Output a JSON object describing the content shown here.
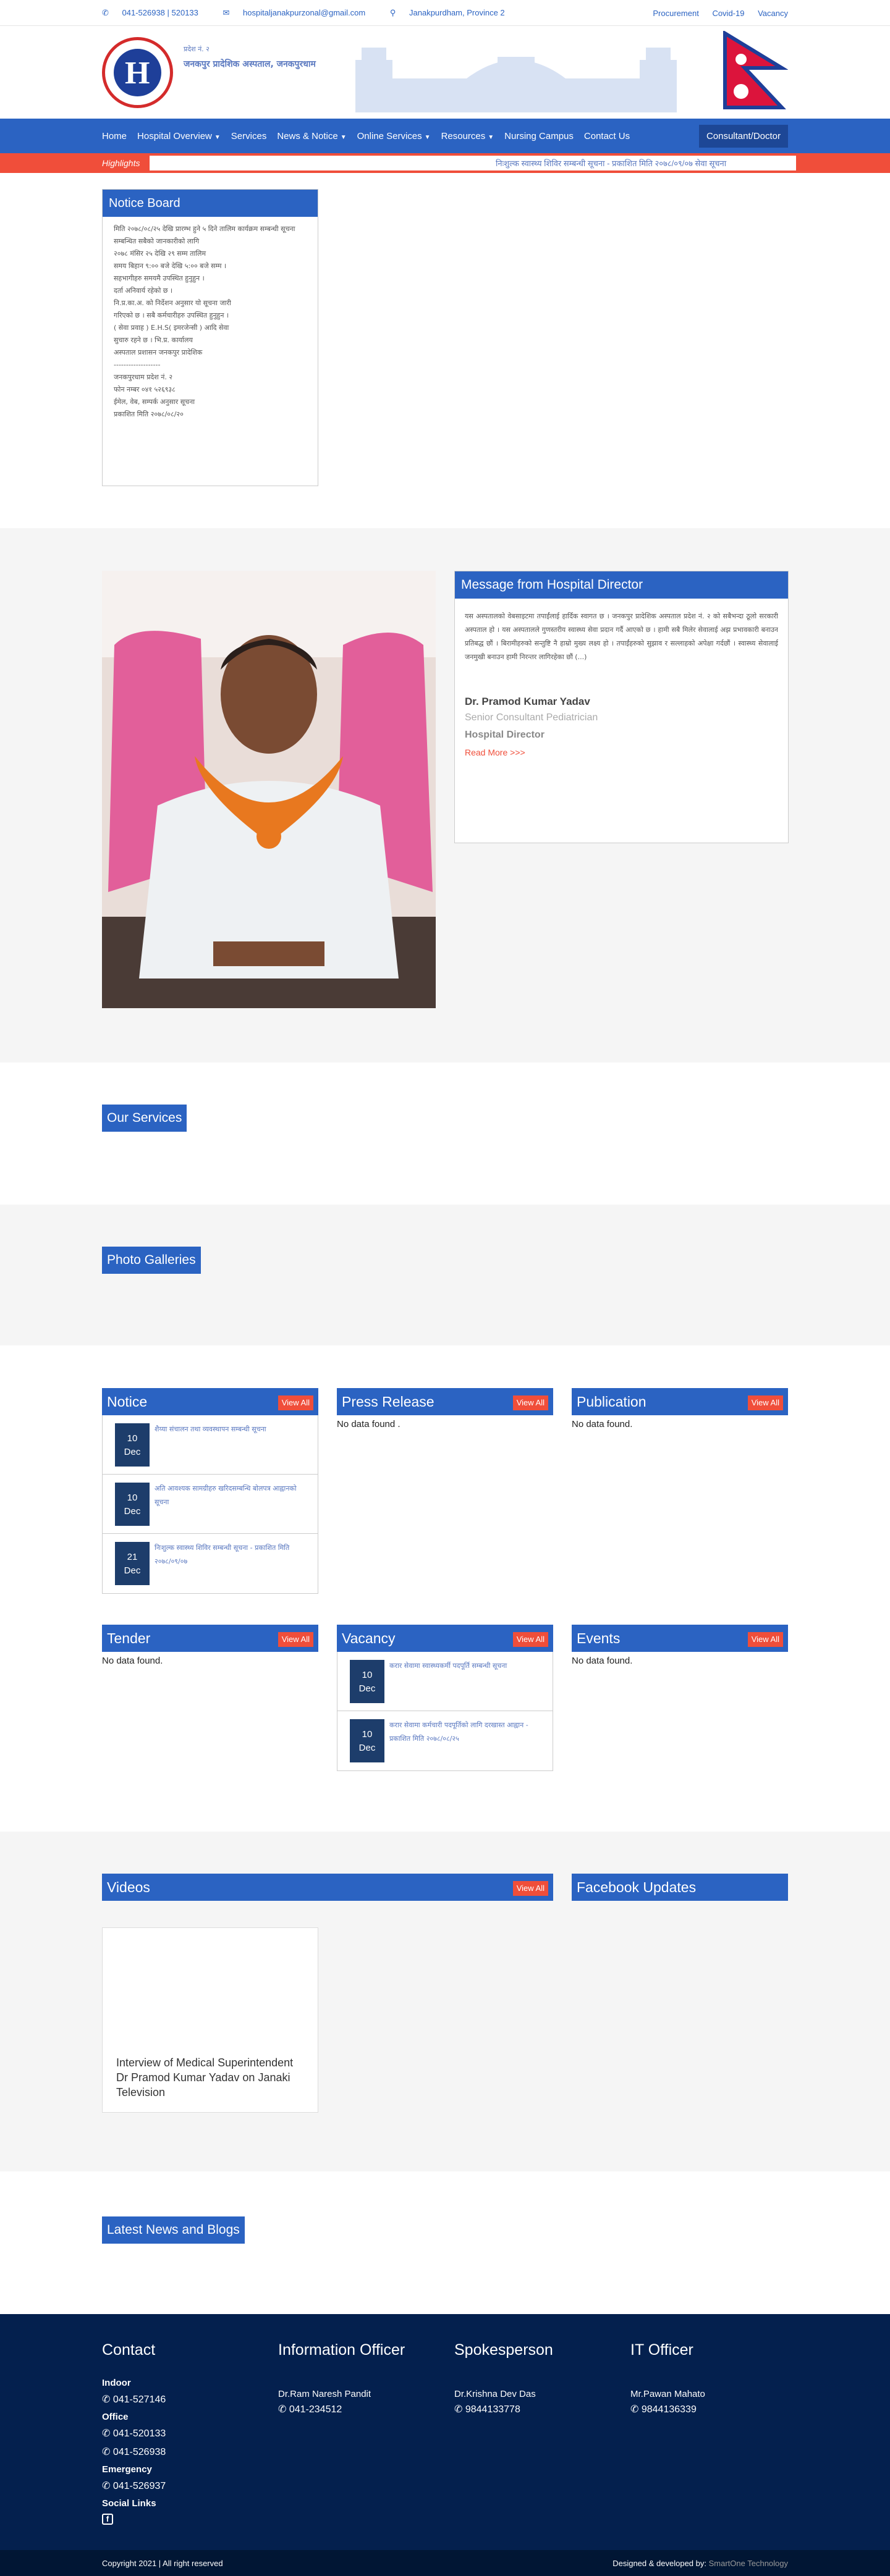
{
  "topbar": {
    "phone": "041-526938 | 520133",
    "email": "hospitaljanakpurzonal@gmail.com",
    "address": "Janakpurdham, Province 2",
    "links": [
      "Procurement",
      "Covid-19",
      "Vacancy"
    ]
  },
  "header": {
    "line1": "प्रदेश नं. २",
    "line2": "जनकपुर प्रादेशिक अस्पताल, जनकपुरधाम",
    "logo_letter": "H"
  },
  "nav": {
    "items": [
      {
        "label": "Home",
        "dropdown": false
      },
      {
        "label": "Hospital Overview",
        "dropdown": true
      },
      {
        "label": "Services",
        "dropdown": false
      },
      {
        "label": "News & Notice",
        "dropdown": true
      },
      {
        "label": "Online Services",
        "dropdown": true
      },
      {
        "label": "Resources",
        "dropdown": true
      },
      {
        "label": "Nursing Campus",
        "dropdown": false
      },
      {
        "label": "Contact Us",
        "dropdown": false
      }
    ],
    "consultant": "Consultant/Doctor"
  },
  "highlights": {
    "label": "Highlights",
    "ticker": "निःशुल्क स्वास्थ्य शिविर सम्बन्धी सूचना - प्रकाशित मिति २०७८/०९/०७        सेवा सूचना"
  },
  "notice_board": {
    "title": "Notice Board",
    "lines": [
      "मिति २०७८/०८/२५ देखि प्रारम्भ हुने ५ दिने तालिम कार्यक्रम सम्बन्धी सूचना",
      "सम्बन्धित सबैको जानकारीको लागि",
      "२०७८ मंसिर २५ देखि २९ सम्म तालिम",
      "समय बिहान ९:०० बजे देखि ५:०० बजे सम्म ।",
      "सहभागीहरु समयमै उपस्थित हुनुहुन ।",
      "दर्ता अनिवार्य रहेको छ ।",
      "नि.प्र.का.अ. को निर्देशन अनुसार यो सूचना जारी",
      "गरिएको छ । सबै कर्मचारीहरु उपस्थित हुनुहुन ।",
      "( सेवा प्रवाह ) E.H.S( इमरजेन्सी ) आदि सेवा",
      "सुचारु रहने छ । भि.प्र. कार्यालय",
      "अस्पताल प्रशासन जनकपुर प्रादेशिक",
      "-------------------",
      "जनकपुरधाम प्रदेश नं. २",
      "फोन नम्बर ०४१ ५२६९३८",
      "ईमेल, वेब, सम्पर्क अनुसार सूचना",
      "प्रकाशित मिति २०७८/०८/२०"
    ]
  },
  "director": {
    "title": "Message from Hospital Director",
    "message": "यस अस्पतालको वेबसाइटमा तपाईंलाई हार्दिक स्वागत छ । जनकपुर प्रादेशिक अस्पताल प्रदेश नं. २ को सबैभन्दा ठूलो सरकारी अस्पताल हो । यस अस्पतालले गुणस्तरीय स्वास्थ्य सेवा प्रदान गर्दै आएको छ । हामी सबै मिलेर सेवालाई अझ प्रभावकारी बनाउन प्रतिबद्ध छौं । बिरामीहरुको सन्तुष्टि नै हाम्रो मुख्य लक्ष्य हो । तपाईंहरुको सुझाव र सल्लाहको अपेक्षा गर्दछौं । स्वास्थ्य सेवालाई जनमुखी बनाउन हामी निरन्तर लागिरहेका छौं (...)",
    "name": "Dr. Pramod Kumar Yadav",
    "role": "Senior Consultant Pediatrician",
    "position": "Hospital Director",
    "read_more": "Read More >>>"
  },
  "sections": {
    "services": "Our Services",
    "galleries": "Photo Galleries",
    "news": "Latest News and Blogs",
    "videos": "Videos",
    "facebook": "Facebook Updates"
  },
  "view_all": "View All",
  "no_data": "No data found.",
  "no_data_dot": "No data found .",
  "cards": {
    "notice": {
      "title": "Notice",
      "items": [
        {
          "day": "10",
          "month": "Dec",
          "text": "शैय्या संचालन तथा व्यवस्थापन सम्बन्धी सूचना"
        },
        {
          "day": "10",
          "month": "Dec",
          "text": "अति आवश्यक सामग्रीहरु खरिदसम्बन्धि बोलपत्र आह्वानको सूचना"
        },
        {
          "day": "21",
          "month": "Dec",
          "text": "निःशुल्क स्वास्थ्य शिविर सम्बन्धी सूचना - प्रकाशित मिति २०७८/०९/०७"
        }
      ]
    },
    "press": {
      "title": "Press Release"
    },
    "publication": {
      "title": "Publication"
    },
    "tender": {
      "title": "Tender"
    },
    "vacancy": {
      "title": "Vacancy",
      "items": [
        {
          "day": "10",
          "month": "Dec",
          "text": "करार सेवामा स्वास्थ्यकर्मी पदपूर्ति सम्बन्धी सूचना"
        },
        {
          "day": "10",
          "month": "Dec",
          "text": "करार सेवामा कर्मचारी पदपूर्तिको लागि दरखास्त आह्वान - प्रकाशित मिति २०७८/०८/२५"
        }
      ]
    },
    "events": {
      "title": "Events"
    }
  },
  "video": {
    "title": "Interview of Medical Superintendent Dr Pramod Kumar Yadav on Janaki Television"
  },
  "footer": {
    "contact": {
      "title": "Contact",
      "indoor_label": "Indoor",
      "indoor": "041-527146",
      "office_label": "Office",
      "office1": "041-520133",
      "office2": "041-526938",
      "emergency_label": "Emergency",
      "emergency": "041-526937",
      "social_label": "Social Links"
    },
    "info": {
      "title": "Information Officer",
      "name": "Dr.Ram Naresh Pandit",
      "phone": "041-234512"
    },
    "spokes": {
      "title": "Spokesperson",
      "name": "Dr.Krishna Dev Das",
      "phone": "9844133778"
    },
    "it": {
      "title": "IT Officer",
      "name": "Mr.Pawan Mahato",
      "phone": "9844136339"
    },
    "copyright": "Copyright 2021 | All right reserved",
    "designed": "Designed & developed by: ",
    "developer": "SmartOne Technology"
  },
  "colors": {
    "primary": "#2b63c2",
    "accent": "#f04e3a",
    "footer": "#04204e"
  }
}
